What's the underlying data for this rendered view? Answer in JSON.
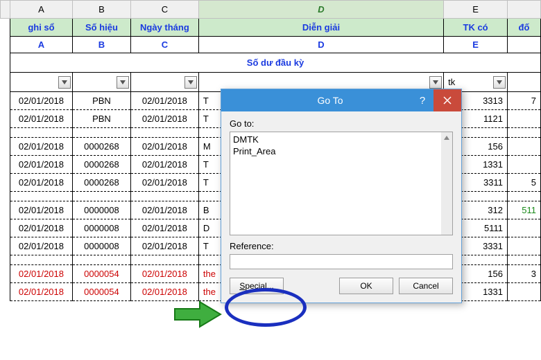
{
  "columns": {
    "A": "A",
    "B": "B",
    "C": "C",
    "D": "D",
    "E": "E"
  },
  "headers": {
    "A": "ghi sổ",
    "B": "Số hiệu",
    "C": "Ngày tháng",
    "D": "Diễn giải",
    "E": "TK có",
    "F": "đố"
  },
  "sub": {
    "A": "A",
    "B": "B",
    "C": "C",
    "D": "D",
    "E": "E"
  },
  "filterE": "tk",
  "subtitle": "Số dư đầu kỳ",
  "rows": [
    {
      "a": "02/01/2018",
      "b": "PBN",
      "c": "02/01/2018",
      "d": "T",
      "e": "3313",
      "f": "7"
    },
    {
      "a": "02/01/2018",
      "b": "PBN",
      "c": "02/01/2018",
      "d": "T",
      "e": "1121",
      "f": ""
    },
    {
      "blank": true
    },
    {
      "a": "02/01/2018",
      "b": "0000268",
      "c": "02/01/2018",
      "d": "M",
      "e": "156",
      "f": ""
    },
    {
      "a": "02/01/2018",
      "b": "0000268",
      "c": "02/01/2018",
      "d": "T",
      "e": "1331",
      "f": ""
    },
    {
      "a": "02/01/2018",
      "b": "0000268",
      "c": "02/01/2018",
      "d": "T",
      "e": "3311",
      "f": "5"
    },
    {
      "blank": true
    },
    {
      "a": "02/01/2018",
      "b": "0000008",
      "c": "02/01/2018",
      "d": "B",
      "e": "312",
      "f": "511",
      "fgreen": true
    },
    {
      "a": "02/01/2018",
      "b": "0000008",
      "c": "02/01/2018",
      "d": "D",
      "e": "5111",
      "f": ""
    },
    {
      "a": "02/01/2018",
      "b": "0000008",
      "c": "02/01/2018",
      "d": "T",
      "e": "3331",
      "f": ""
    },
    {
      "blank": true
    },
    {
      "a": "02/01/2018",
      "b": "0000054",
      "c": "02/01/2018",
      "d": "the",
      "e": "156",
      "f": "3",
      "red": true
    },
    {
      "a": "02/01/2018",
      "b": "0000054",
      "c": "02/01/2018",
      "d": "the",
      "e": "1331",
      "f": "",
      "red": true
    }
  ],
  "dialog": {
    "title": "Go To",
    "goto_label": "Go to:",
    "items": [
      "DMTK",
      "Print_Area"
    ],
    "ref_label": "Reference:",
    "ref_value": "",
    "special": "Special...",
    "ok": "OK",
    "cancel": "Cancel"
  }
}
